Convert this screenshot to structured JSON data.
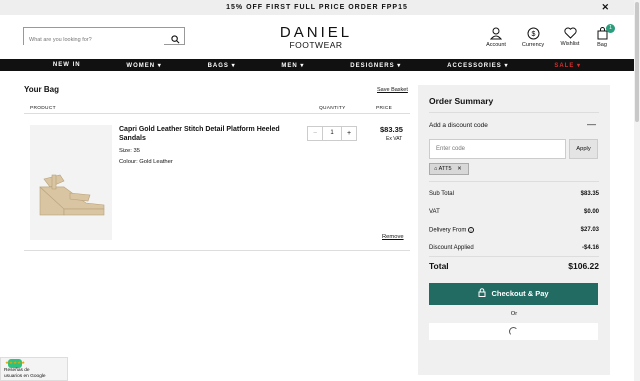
{
  "promo": {
    "text": "15% OFF FIRST FULL PRICE ORDER FPP15",
    "close": "✕"
  },
  "search": {
    "placeholder": "What are you looking for?"
  },
  "logo": {
    "line1": "DANIEL",
    "line2": "FOOTWEAR"
  },
  "header_actions": {
    "account": "Account",
    "currency": "Currency",
    "wishlist": "Wishlist",
    "bag": "Bag",
    "bag_count": "1"
  },
  "nav": {
    "items": [
      "NEW IN",
      "WOMEN ▾",
      "BAGS ▾",
      "MEN ▾",
      "DESIGNERS ▾",
      "ACCESSORIES ▾",
      "SALE ▾"
    ]
  },
  "bag": {
    "title": "Your Bag",
    "save_basket": "Save Basket",
    "col_product": "PRODUCT",
    "col_quantity": "QUANTITY",
    "col_price": "PRICE",
    "item": {
      "name": "Capri Gold Leather Stitch Detail Platform Heeled Sandals",
      "size": "Size: 35",
      "colour": "Colour: Gold Leather",
      "qty_minus": "−",
      "quantity": "1",
      "qty_plus": "+",
      "price": "$83.35",
      "vat_note": "Ex VAT",
      "remove": "Remove"
    }
  },
  "summary": {
    "title": "Order Summary",
    "discount_label": "Add a discount code",
    "discount_toggle": "—",
    "code_placeholder": "Enter code",
    "apply": "Apply",
    "chip_code": "ATT5",
    "chip_close": "✕",
    "rows": [
      {
        "label": "Sub Total",
        "value": "$83.35"
      },
      {
        "label": "VAT",
        "value": "$0.00"
      },
      {
        "label": "Delivery From",
        "value": "$27.03"
      },
      {
        "label": "Discount Applied",
        "value": "-$4.16"
      }
    ],
    "total_label": "Total",
    "total_value": "$106.22",
    "checkout": "Checkout & Pay",
    "or": "Or"
  },
  "reviews": {
    "text_line1": "Reseñas de",
    "text_line2": "usuarios en Google",
    "stars": "★★★★★"
  },
  "colors": {
    "accent": "#226b63",
    "sale": "#d32f2f",
    "badge": "#2a9d7c"
  }
}
